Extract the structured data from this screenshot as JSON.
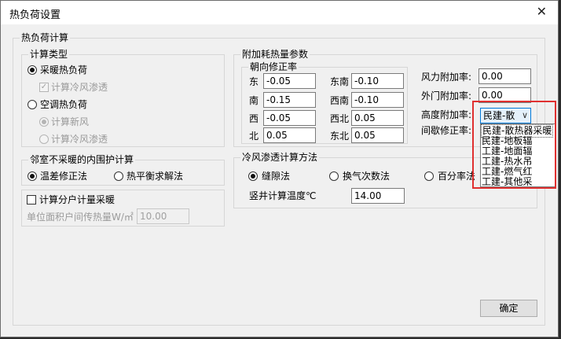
{
  "window": {
    "title": "热负荷设置",
    "close_glyph": "✕"
  },
  "calc": {
    "group_label": "热负荷计算",
    "calc_type": {
      "label": "计算类型",
      "heating_load": "采暖热负荷",
      "cold_air_infiltration": "计算冷风渗透",
      "ac_load": "空调热负荷",
      "fresh_air": "计算新风",
      "cold_air_infiltration_2": "计算冷风渗透"
    },
    "adjacent": {
      "label": "邻室不采暖的内围护计算",
      "temp_diff": "温差修正法",
      "heat_balance": "热平衡求解法"
    },
    "household": {
      "checkbox_label": "计算分户计量采暖",
      "unit_label": "单位面积户间传热量W/㎡",
      "unit_value": "10.00"
    }
  },
  "additional": {
    "label": "附加耗热量参数",
    "orientation": {
      "label": "朝向修正率",
      "east": {
        "label": "东",
        "value": "-0.05"
      },
      "southeast": {
        "label": "东南",
        "value": "-0.10"
      },
      "south": {
        "label": "南",
        "value": "-0.15"
      },
      "southwest": {
        "label": "西南",
        "value": "-0.10"
      },
      "west": {
        "label": "西",
        "value": "-0.05"
      },
      "northwest": {
        "label": "西北",
        "value": "0.05"
      },
      "north": {
        "label": "北",
        "value": "0.05"
      },
      "northeast": {
        "label": "东北",
        "value": "0.05"
      }
    },
    "wind": {
      "label": "风力附加率:",
      "value": "0.00"
    },
    "door": {
      "label": "外门附加率:",
      "value": "0.00"
    },
    "height": {
      "label": "高度附加率:",
      "selected": "民建-散",
      "arrow": "∨",
      "options": [
        "民建-散热器采暖",
        "民建-地板辐",
        "工建-地面辐",
        "工建-热水吊",
        "工建-燃气红",
        "工建-其他采"
      ]
    },
    "intermittent": {
      "label": "间歇修正率:"
    }
  },
  "infiltration": {
    "label": "冷风渗透计算方法",
    "gap": "缝隙法",
    "air_change": "换气次数法",
    "percent": "百分率法",
    "shaft_label": "竖井计算温度℃",
    "shaft_value": "14.00"
  },
  "ok_button": "确定"
}
